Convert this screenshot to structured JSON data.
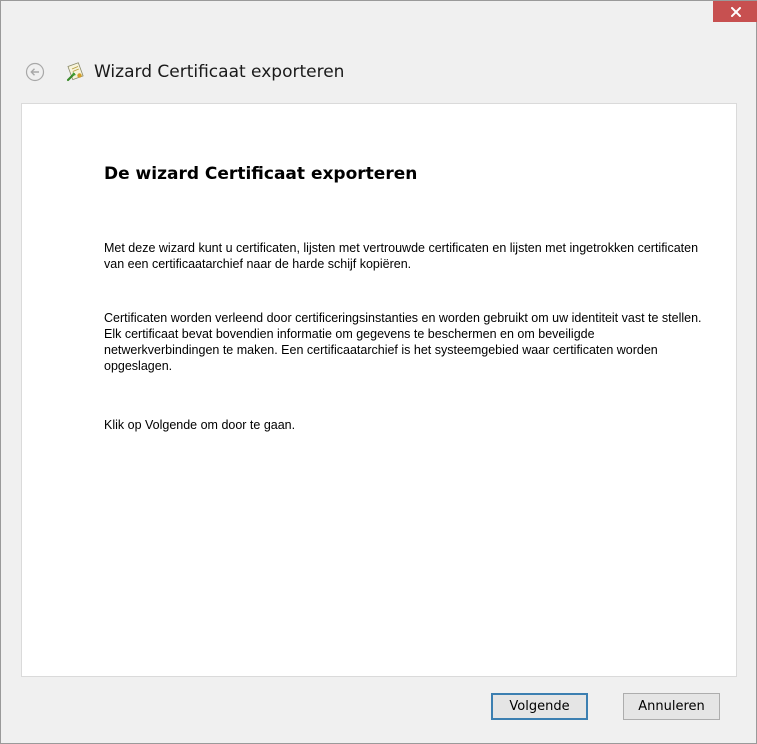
{
  "window": {
    "title": "Wizard Certificaat exporteren"
  },
  "titlebar": {
    "close_icon": "close-icon"
  },
  "header": {
    "back_icon": "back-arrow-icon",
    "wizard_icon": "certificate-icon"
  },
  "content": {
    "heading": "De wizard Certificaat exporteren",
    "paragraphs": [
      "Met deze wizard kunt u certificaten, lijsten met vertrouwde certificaten en lijsten met ingetrokken certificaten van een certificaatarchief naar de harde schijf kopiëren.",
      "Certificaten worden verleend door certificeringsinstanties en worden gebruikt om uw identiteit vast te stellen. Elk certificaat bevat bovendien informatie om gegevens te beschermen en om beveiligde netwerkverbindingen te maken. Een certificaatarchief is het systeemgebied waar certificaten worden opgeslagen.",
      "Klik op Volgende om door te gaan."
    ]
  },
  "footer": {
    "next_label": "Volgende",
    "cancel_label": "Annuleren"
  },
  "colors": {
    "close_button": "#c75050",
    "primary_border": "#3c7fb1",
    "background": "#f0f0f0"
  }
}
